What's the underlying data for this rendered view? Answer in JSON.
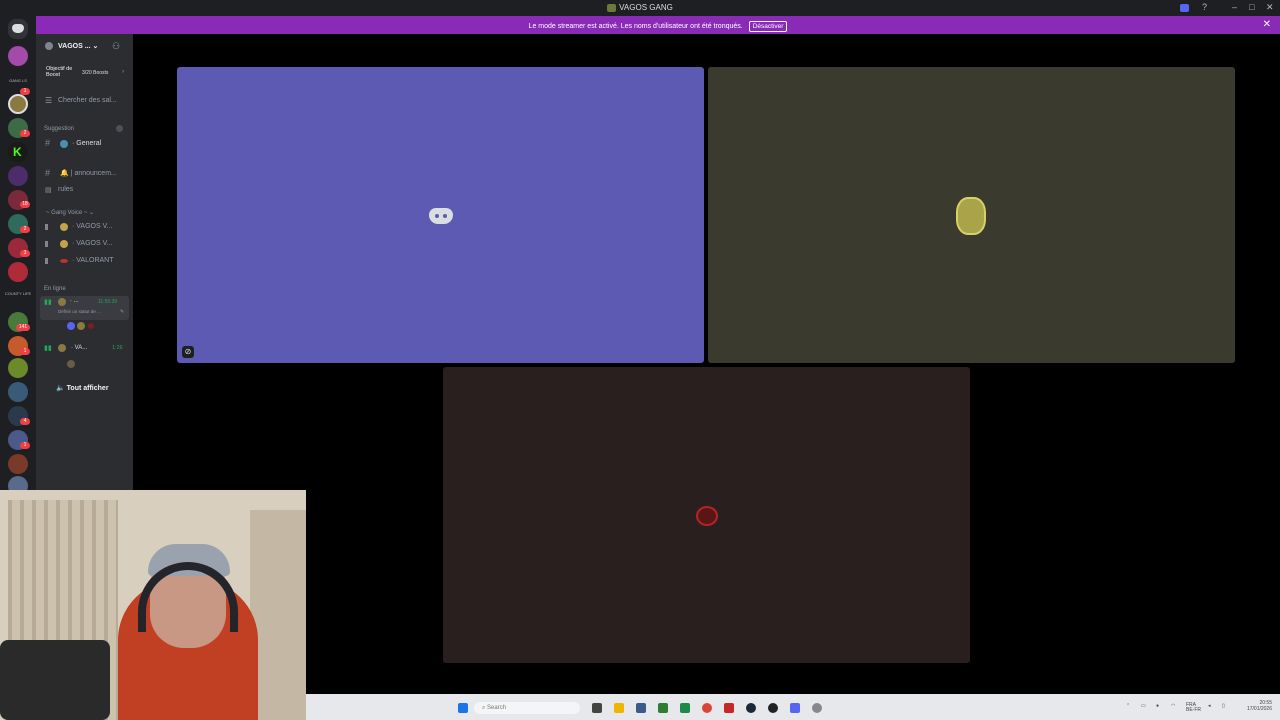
{
  "window": {
    "title": "VAGOS GANG",
    "minimize": "–",
    "maximize": "□",
    "close": "✕"
  },
  "banner": {
    "message": "Le mode streamer est activé. Les noms d'utilisateur ont été tronqués.",
    "button": "Désactiver",
    "close": "✕"
  },
  "rail": {
    "labels": [
      "GANG LS",
      "COUNTY LIFE"
    ],
    "badges": [
      "1",
      "2",
      "18",
      "2",
      "3",
      "141",
      "1",
      "4",
      "1"
    ]
  },
  "server": {
    "name": "VAGOS ...",
    "boost_label": "Objectif de Boost",
    "boost_count": "3/20 Boosts",
    "search": "Chercher des sal...",
    "category_suggestion": "Suggestion",
    "channels": [
      "General",
      "announcem...",
      "rules"
    ],
    "category_voice": "Gang Voice",
    "voice_channels": [
      "VAGOS V...",
      "VAGOS V...",
      "VALORANT"
    ],
    "online_label": "En ligne",
    "user1": {
      "name": "...",
      "time": "11:55:29",
      "status": "Définir un statut de ..."
    },
    "user2": {
      "name": "VA...",
      "time": "1:26"
    },
    "show_all": "Tout afficher"
  },
  "taskbar": {
    "search": "Search",
    "tray_lang": "FRA\nBE-FR",
    "clock_time": "20:55",
    "clock_date": "17/01/2026"
  },
  "colors": {
    "banner": "#8a2bb8",
    "tile_discord": "#5d5ab3",
    "tile_gang": "#3a3a2e",
    "tile_red": "#2a1f1f",
    "online": "#23a55a"
  }
}
